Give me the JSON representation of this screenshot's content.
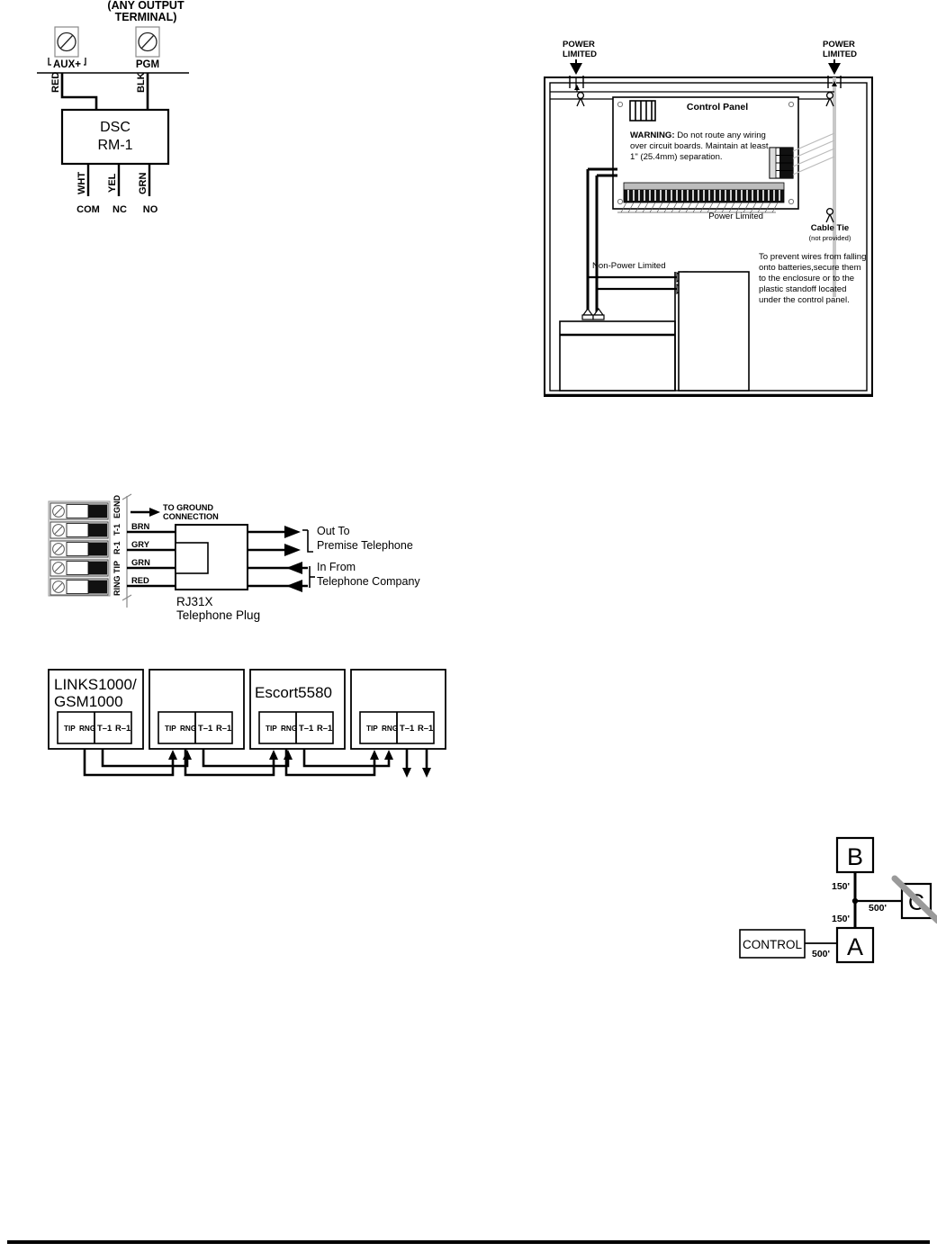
{
  "figures": {
    "rm1": {
      "title": "(ANY OUTPUT TERMINAL)",
      "title_line1": "(ANY OUTPUT",
      "title_line2": "TERMINAL)",
      "terminals": [
        {
          "label": "AUX+",
          "icon": "screw-terminal-icon"
        },
        {
          "label": "PGM",
          "icon": "screw-terminal-icon"
        }
      ],
      "wires_top": [
        "RED",
        "BLK"
      ],
      "module_line1": "DSC",
      "module_line2": "RM-1",
      "wires_bottom": [
        "WHT",
        "YEL",
        "GRN"
      ],
      "contacts": [
        "COM",
        "NC",
        "NO"
      ]
    },
    "enclosure": {
      "knockout_left_line1": "POWER",
      "knockout_left_line2": "LIMITED",
      "knockout_right_line1": "POWER",
      "knockout_right_line2": "LIMITED",
      "panel_title": "Control Panel",
      "warning_label": "WARNING:",
      "warning_line1": " Do not route any wiring",
      "warning_line2": "over circuit boards. Maintain at least",
      "warning_line3": "1\" (25.4mm) separation.",
      "power_limited_label": "Power Limited",
      "cable_tie_label": "Cable Tie",
      "cable_tie_sub": "(not provided)",
      "non_power_limited_label": "Non-Power Limited",
      "note_line1": "To prevent wires from falling",
      "note_line2": "onto batteries,secure them",
      "note_line3": "to the enclosure or to the",
      "note_line4": "plastic standoff located",
      "note_line5": "under the control panel."
    },
    "rj31x": {
      "terminal_labels": [
        "EGND",
        "T-1",
        "R-1",
        "TIP",
        "RING"
      ],
      "ground_line1": "TO GROUND",
      "ground_line2": "CONNECTION",
      "wire_labels": [
        "BRN",
        "GRY",
        "GRN",
        "RED"
      ],
      "plug_line1": "RJ31X",
      "plug_line2": "Telephone Plug",
      "out_line1": "Out To",
      "out_line2": "Premise Telephone",
      "in_line1": "In From",
      "in_line2": "Telephone Company"
    },
    "modules": {
      "boxes": [
        {
          "title_line1": "LINKS1000/",
          "title_line2": "GSM1000",
          "pins": [
            "TIP",
            "RNG",
            "T–1",
            "R–1"
          ]
        },
        {
          "title_line1": "",
          "title_line2": "",
          "pins": [
            "TIP",
            "RNG",
            "T–1",
            "R–1"
          ]
        },
        {
          "title_line1": "Escort5580",
          "title_line2": "",
          "pins": [
            "TIP",
            "RNG",
            "T–1",
            "R–1"
          ]
        },
        {
          "title_line1": "",
          "title_line2": "",
          "pins": [
            "TIP",
            "RNG",
            "T–1",
            "R–1"
          ]
        }
      ]
    },
    "wire_run": {
      "control_label": "CONTROL",
      "node_a": "A",
      "node_b": "B",
      "node_c": "C",
      "distance_control_a": "500'",
      "distance_a_junction": "150'",
      "distance_junction_b": "150'",
      "distance_junction_c": "500'",
      "c_invalid": true
    }
  },
  "colors": {
    "ink": "#000000",
    "gray_fill": "#c8c8c8",
    "light_gray": "#d4d4d4",
    "strike": "#999999"
  }
}
